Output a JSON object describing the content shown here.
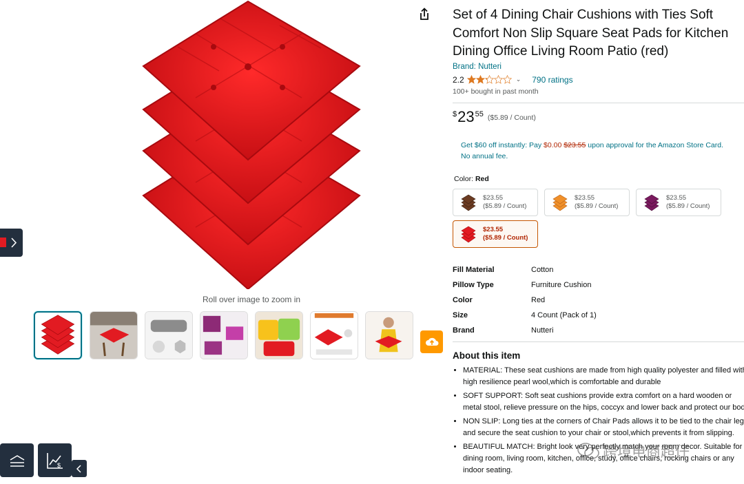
{
  "product": {
    "title": "Set of 4 Dining Chair Cushions with Ties Soft Comfort Non Slip Square Seat Pads for Kitchen Dining Office Living Room Patio (red)",
    "title_lines": [
      "Set of 4 Dining Chair Cushions with Ties Soft",
      "Comfort Non Slip Square Seat Pads for Kitchen",
      "Dining Office Living Room Patio (red)"
    ],
    "brand_link": "Brand: Nutteri",
    "rating_value": "2.2",
    "rating_count_text": "790 ratings",
    "bought_text": "100+ bought in past month"
  },
  "gallery": {
    "zoom_hint": "Roll over image to zoom in",
    "thumbnail_count": 7,
    "active_thumbnail": 1
  },
  "price": {
    "currency_symbol": "$",
    "dollars": "23",
    "cents": "55",
    "per_unit": "($5.89 / Count)"
  },
  "promo": {
    "part1": "Get $60 off instantly: Pay ",
    "pay_amount": "$0.00",
    "original_amount": "$23.55",
    "part2": " upon approval for the Amazon Store Card.",
    "line2": "No annual fee."
  },
  "color": {
    "label": "Color:",
    "selected": "Red",
    "options": [
      {
        "price": "$23.55",
        "per_unit": "($5.89 / Count)",
        "color": "#6b3b22"
      },
      {
        "price": "$23.55",
        "per_unit": "($5.89 / Count)",
        "color": "#f0902a"
      },
      {
        "price": "$23.55",
        "per_unit": "($5.89 / Count)",
        "color": "#7a1a5e"
      },
      {
        "price": "$23.55",
        "per_unit": "($5.89 / Count)",
        "color": "#e21b22"
      }
    ]
  },
  "specs": [
    {
      "key": "Fill Material",
      "value": "Cotton"
    },
    {
      "key": "Pillow Type",
      "value": "Furniture Cushion"
    },
    {
      "key": "Color",
      "value": "Red"
    },
    {
      "key": "Size",
      "value": "4 Count (Pack of 1)"
    },
    {
      "key": "Brand",
      "value": "Nutteri"
    }
  ],
  "about": {
    "heading": "About this item",
    "bullets": [
      "MATERIAL: These seat cushions are made from high quality polyester and filled with high resilience pearl wool,which is comfortable and durable",
      "SOFT SUPPORT: Soft seat cushions provide extra comfort on a hard wooden or metal stool, relieve pressure on the hips, coccyx and lower back and protect our body.",
      "NON SLIP: Long ties at the corners of Chair Pads allows it to be tied to the chair legs and secure the seat cushion to your chair or stool,which prevents it from slipping.",
      "BEAUTIFUL MATCH: Bright look very perfectly match your room decor. Suitable for dining room, living room, kitchen, office, study, office chairs, rocking chairs or any indoor seating."
    ]
  },
  "watermark": "跨境电商超仔",
  "colors": {
    "link": "#007185",
    "price_red": "#b12704",
    "star": "#de7921",
    "cushion_red": "#e21b22",
    "nav_dark": "#232f3e",
    "accent_orange": "#ff9900"
  },
  "icons": [
    "share-icon",
    "star-icon",
    "chevron-down-icon",
    "cloud-upload-icon",
    "chevron-right-icon",
    "menu-icon",
    "chart-icon",
    "chevron-left-icon",
    "wechat-icon"
  ]
}
